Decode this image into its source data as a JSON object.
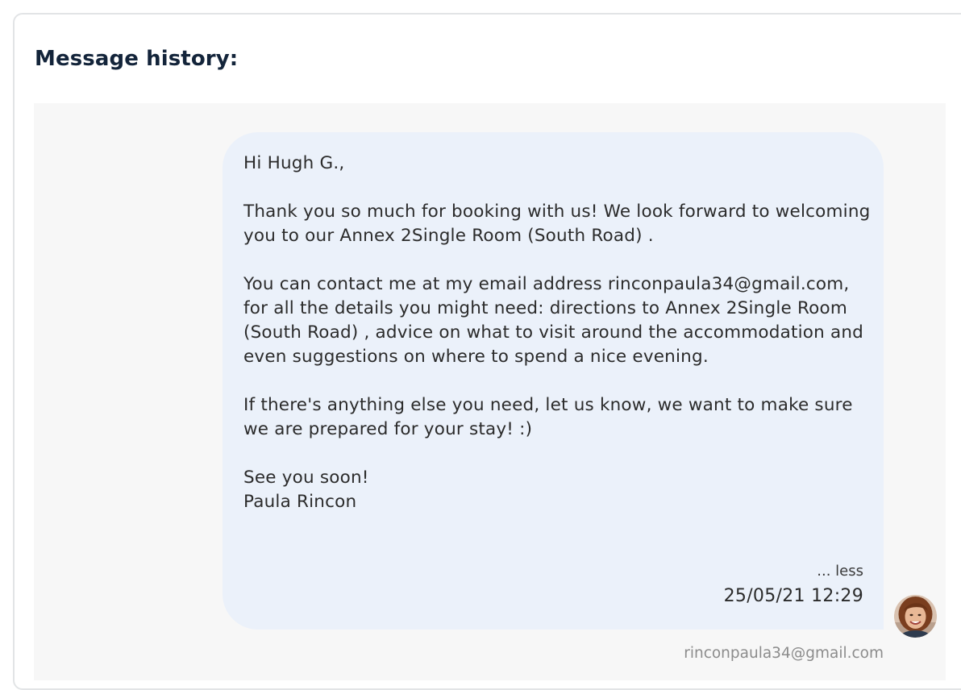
{
  "panel": {
    "title": "Message history:"
  },
  "message": {
    "text": "Hi Hugh G.,\n\nThank you so much for booking with us! We look forward to welcoming you to our Annex 2Single Room (South Road) .\n\nYou can contact me at my email address rinconpaula34@gmail.com, for all the details you might need: directions to Annex 2Single Room (South Road) , advice on what to visit around the accommodation and even suggestions on where to spend a nice evening.\n\nIf there's anything else you need, let us know, we want to make sure we are prepared for your stay! :)\n\nSee you soon!\nPaula Rincon",
    "toggle_label": "... less",
    "timestamp": "25/05/21 12:29",
    "sender": "rinconpaula34@gmail.com",
    "avatar_icon": "user-avatar-photo",
    "bubble_color": "#ebf1fa"
  }
}
